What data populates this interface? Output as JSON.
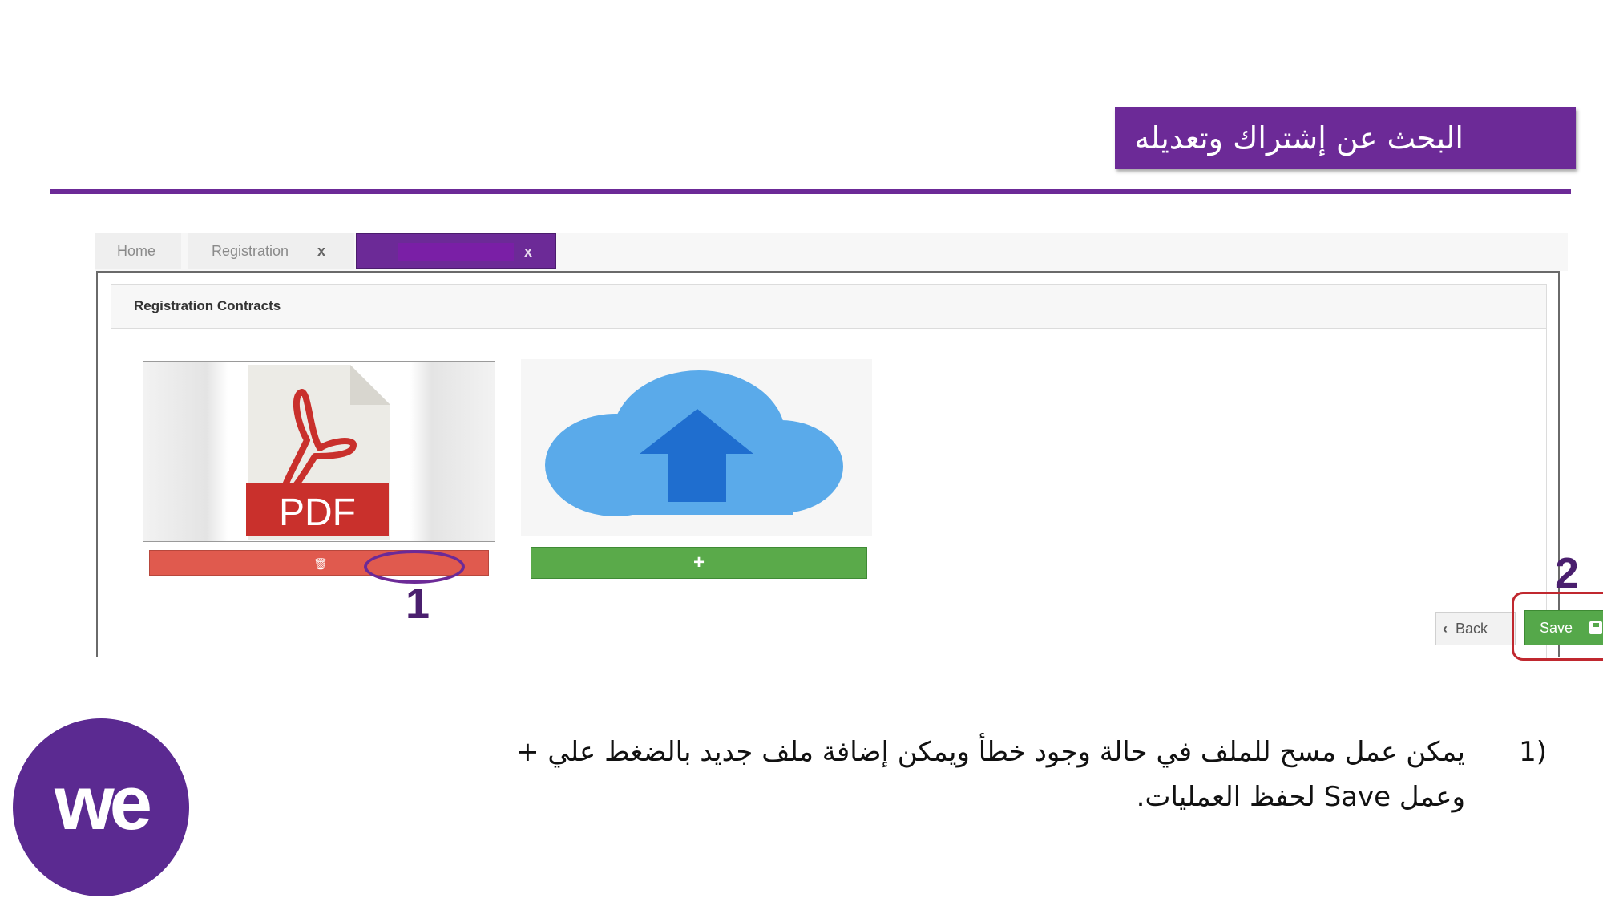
{
  "slide": {
    "title": "البحث عن إشتراك وتعديله",
    "description_number": "(1",
    "description_line1": "يمكن عمل مسح للملف في حالة وجود خطأ ويمكن إضافة ملف جديد بالضغط علي +",
    "description_line2": "وعمل Save لحفظ العمليات.",
    "logo": "we",
    "accent_color": "#6c2a97"
  },
  "screenshot": {
    "tabs": [
      {
        "label": "Home"
      },
      {
        "label": "Registration",
        "close": "x"
      },
      {
        "label": "",
        "close": "x",
        "active": true
      }
    ],
    "panel_title": "Registration Contracts",
    "pdf_label": "PDF",
    "add_label": "+",
    "back_label": "Back",
    "save_label": "Save",
    "step1": "1",
    "step2": "2",
    "icons": {
      "pdf": "pdf-file-icon",
      "upload": "cloud-upload-icon",
      "delete": "trash-icon",
      "back": "chevron-left-icon",
      "save": "floppy-disk-icon"
    },
    "colors": {
      "delete_button": "#e05a4e",
      "add_button": "#5aaa4a",
      "save_button": "#55a84a",
      "highlight": "#c0282f"
    }
  }
}
